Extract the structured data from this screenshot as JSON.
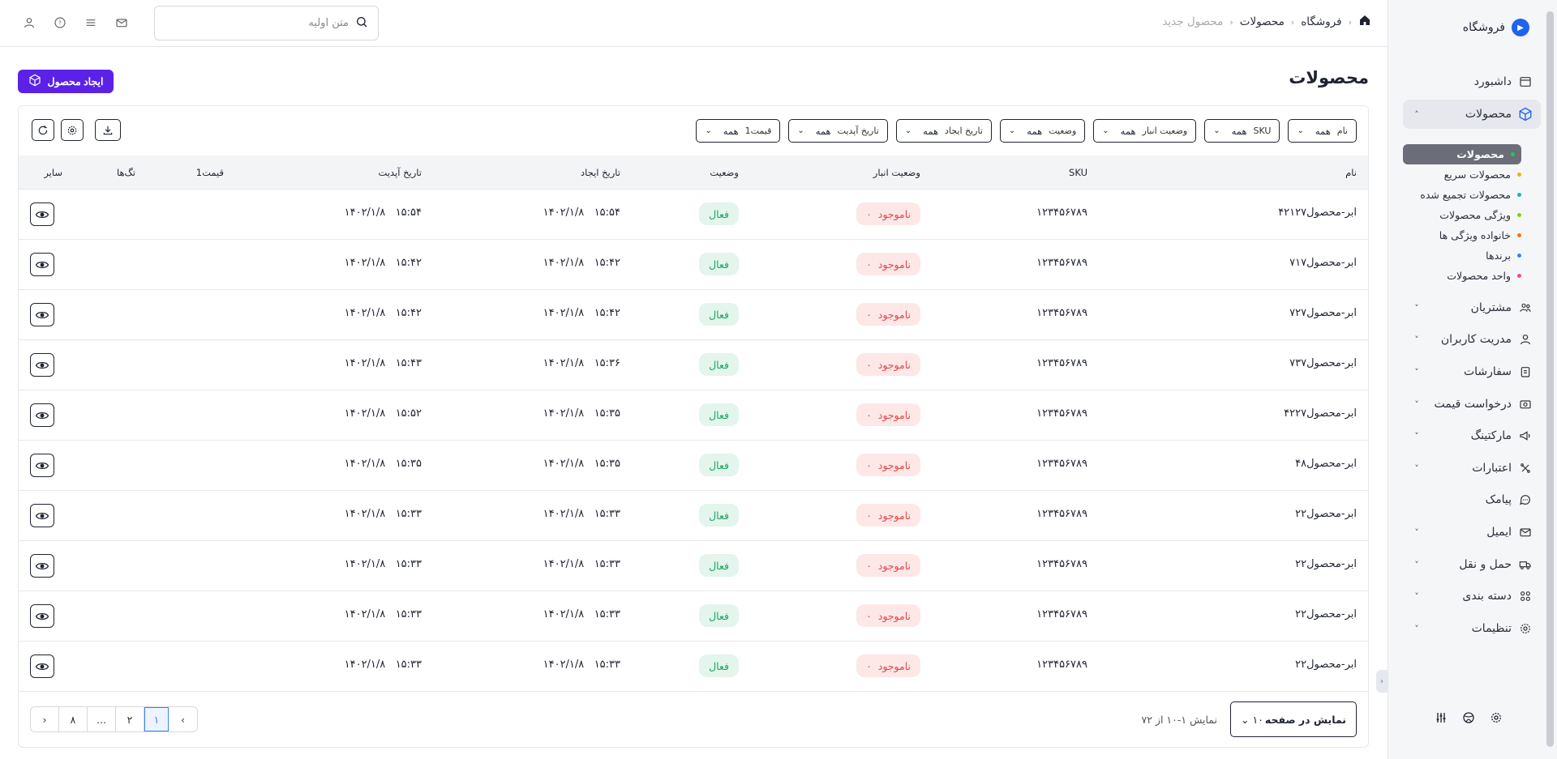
{
  "sidebar": {
    "brand": "فروشگاه",
    "items": [
      {
        "label": "داشبورد",
        "icon": "dashboard-icon",
        "active": false,
        "chevron": false
      },
      {
        "label": "محصولات",
        "icon": "box-icon",
        "active": true,
        "chevron": "up"
      },
      {
        "label": "مشتریان",
        "icon": "customers-icon",
        "chevron": "down"
      },
      {
        "label": "مدریت کاربران",
        "icon": "users-icon",
        "chevron": "down"
      },
      {
        "label": "سفارشات",
        "icon": "orders-icon",
        "chevron": "down"
      },
      {
        "label": "درخواست قیمت",
        "icon": "price-request-icon",
        "chevron": "down"
      },
      {
        "label": "مارکتینگ",
        "icon": "megaphone-icon",
        "chevron": "down"
      },
      {
        "label": "اعتبارات",
        "icon": "credit-icon",
        "chevron": "down"
      },
      {
        "label": "پیامک",
        "icon": "sms-icon",
        "chevron": false
      },
      {
        "label": "ایمیل",
        "icon": "mail-icon",
        "chevron": "down"
      },
      {
        "label": "حمل و نقل",
        "icon": "truck-icon",
        "chevron": "down"
      },
      {
        "label": "دسته بندی",
        "icon": "category-icon",
        "chevron": "down"
      },
      {
        "label": "تنظیمات",
        "icon": "settings-icon",
        "chevron": "down"
      }
    ],
    "sub_items": [
      {
        "label": "محصولات",
        "color": "#22c55e",
        "active": true
      },
      {
        "label": "محصولات سریع",
        "color": "#eab308"
      },
      {
        "label": "محصولات تجمیع شده",
        "color": "#14b8a6"
      },
      {
        "label": "ویژگی محصولات",
        "color": "#84cc16"
      },
      {
        "label": "خانواده ویژگی ها",
        "color": "#f97316"
      },
      {
        "label": "برندها",
        "color": "#3b82f6"
      },
      {
        "label": "واحد محصولات",
        "color": "#ec4899"
      }
    ]
  },
  "header": {
    "breadcrumb": [
      "فروشگاه",
      "محصولات",
      "محصول جدید"
    ],
    "search_placeholder": "متن اولیه"
  },
  "page": {
    "title": "محصولات",
    "create_button": "ایجاد محصول"
  },
  "filters": [
    {
      "label": "نام",
      "value": "همه"
    },
    {
      "label": "SKU",
      "value": "همه"
    },
    {
      "label": "وضعیت انبار",
      "value": "همه"
    },
    {
      "label": "وضعیت",
      "value": "همه"
    },
    {
      "label": "تاریخ ایجاد",
      "value": "همه"
    },
    {
      "label": "تاریخ آپدیت",
      "value": "همه"
    },
    {
      "label": "قیمت1",
      "value": "همه"
    }
  ],
  "table": {
    "columns": {
      "name": "نام",
      "sku": "SKU",
      "stock": "وضعیت انبار",
      "status": "وضعیت",
      "created": "تاریخ ایجاد",
      "updated": "تاریخ آپدیت",
      "price": "قیمت1",
      "tags": "تگ‌ها",
      "other": "سایر"
    },
    "rows": [
      {
        "name": "ابر-محصول۴۲۱۲۷",
        "sku": "۱۲۳۴۵۶۷۸۹",
        "stock": "ناموجود",
        "stock_count": "۰",
        "status": "فعال",
        "created_date": "۱۴۰۲/۱/۸",
        "created_time": "۱۵:۵۴",
        "updated_date": "۱۴۰۲/۱/۸",
        "updated_time": "۱۵:۵۴"
      },
      {
        "name": "ابر-محصول۷۱۷",
        "sku": "۱۲۳۴۵۶۷۸۹",
        "stock": "ناموجود",
        "stock_count": "۰",
        "status": "فعال",
        "created_date": "۱۴۰۲/۱/۸",
        "created_time": "۱۵:۴۲",
        "updated_date": "۱۴۰۲/۱/۸",
        "updated_time": "۱۵:۴۲"
      },
      {
        "name": "ابر-محصول۷۲۷",
        "sku": "۱۲۳۴۵۶۷۸۹",
        "stock": "ناموجود",
        "stock_count": "۰",
        "status": "فعال",
        "created_date": "۱۴۰۲/۱/۸",
        "created_time": "۱۵:۴۲",
        "updated_date": "۱۴۰۲/۱/۸",
        "updated_time": "۱۵:۴۲"
      },
      {
        "name": "ابر-محصول۷۳۷",
        "sku": "۱۲۳۴۵۶۷۸۹",
        "stock": "ناموجود",
        "stock_count": "۰",
        "status": "فعال",
        "created_date": "۱۴۰۲/۱/۸",
        "created_time": "۱۵:۳۶",
        "updated_date": "۱۴۰۲/۱/۸",
        "updated_time": "۱۵:۴۳"
      },
      {
        "name": "ابر-محصول۴۲۲۷",
        "sku": "۱۲۳۴۵۶۷۸۹",
        "stock": "ناموجود",
        "stock_count": "۰",
        "status": "فعال",
        "created_date": "۱۴۰۲/۱/۸",
        "created_time": "۱۵:۳۵",
        "updated_date": "۱۴۰۲/۱/۸",
        "updated_time": "۱۵:۵۲"
      },
      {
        "name": "ابر-محصول۴۸",
        "sku": "۱۲۳۴۵۶۷۸۹",
        "stock": "ناموجود",
        "stock_count": "۰",
        "status": "فعال",
        "created_date": "۱۴۰۲/۱/۸",
        "created_time": "۱۵:۳۵",
        "updated_date": "۱۴۰۲/۱/۸",
        "updated_time": "۱۵:۳۵"
      },
      {
        "name": "ابر-محصول۲۲",
        "sku": "۱۲۳۴۵۶۷۸۹",
        "stock": "ناموجود",
        "stock_count": "۰",
        "status": "فعال",
        "created_date": "۱۴۰۲/۱/۸",
        "created_time": "۱۵:۳۳",
        "updated_date": "۱۴۰۲/۱/۸",
        "updated_time": "۱۵:۳۳"
      },
      {
        "name": "ابر-محصول۲۲",
        "sku": "۱۲۳۴۵۶۷۸۹",
        "stock": "ناموجود",
        "stock_count": "۰",
        "status": "فعال",
        "created_date": "۱۴۰۲/۱/۸",
        "created_time": "۱۵:۳۳",
        "updated_date": "۱۴۰۲/۱/۸",
        "updated_time": "۱۵:۳۳"
      },
      {
        "name": "ابر-محصول۲۲",
        "sku": "۱۲۳۴۵۶۷۸۹",
        "stock": "ناموجود",
        "stock_count": "۰",
        "status": "فعال",
        "created_date": "۱۴۰۲/۱/۸",
        "created_time": "۱۵:۳۳",
        "updated_date": "۱۴۰۲/۱/۸",
        "updated_time": "۱۵:۳۳"
      },
      {
        "name": "ابر-محصول۲۲",
        "sku": "۱۲۳۴۵۶۷۸۹",
        "stock": "ناموجود",
        "stock_count": "۰",
        "status": "فعال",
        "created_date": "۱۴۰۲/۱/۸",
        "created_time": "۱۵:۳۳",
        "updated_date": "۱۴۰۲/۱/۸",
        "updated_time": "۱۵:۳۳"
      }
    ]
  },
  "footer": {
    "per_page_label": "نمایش در صفحه",
    "per_page_value": "۱۰",
    "showing": "نمایش ۱-۱۰ از ۷۲",
    "pages": [
      "۱",
      "۲",
      "...",
      "۸"
    ],
    "current_page": "۱",
    "prev": "‹",
    "next": "›"
  },
  "colors": {
    "accent": "#5b21e8",
    "brand_logo": "#1f63f0",
    "stock_out_bg": "#fde7e7",
    "stock_out_text": "#e5484d",
    "active_bg": "#e3f5ec",
    "active_text": "#1ea566"
  }
}
